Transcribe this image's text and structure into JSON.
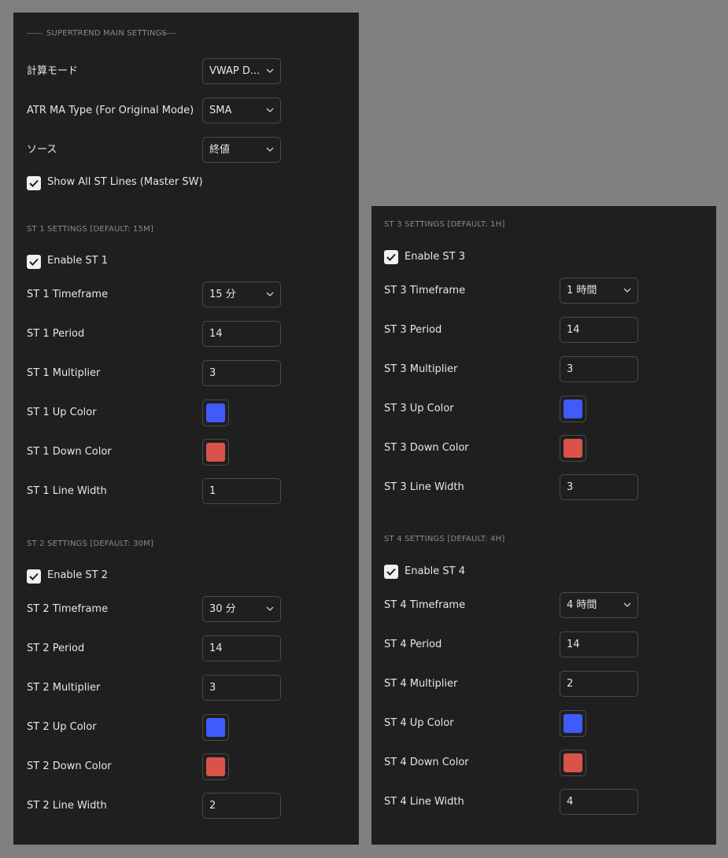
{
  "main": {
    "section_title": "SUPERTREND MAIN SETTINGS",
    "calc_mode": {
      "label": "計算モード",
      "value": "VWAP D..."
    },
    "atr_ma_type": {
      "label": "ATR MA Type (For Original Mode)",
      "value": "SMA"
    },
    "source": {
      "label": "ソース",
      "value": "終値"
    },
    "show_all": {
      "label": "Show All ST Lines (Master SW)",
      "checked": true
    }
  },
  "st1": {
    "section_title": "ST 1 SETTINGS [DEFAULT: 15M]",
    "enable_label": "Enable ST 1",
    "enabled": true,
    "timeframe_label": "ST 1 Timeframe",
    "timeframe_value": "15 分",
    "period_label": "ST 1 Period",
    "period_value": "14",
    "multiplier_label": "ST 1 Multiplier",
    "multiplier_value": "3",
    "up_color_label": "ST 1 Up Color",
    "up_color": "#3f5bfa",
    "down_color_label": "ST 1 Down Color",
    "down_color": "#d9534a",
    "line_width_label": "ST 1 Line Width",
    "line_width_value": "1"
  },
  "st2": {
    "section_title": "ST 2 SETTINGS [DEFAULT: 30M]",
    "enable_label": "Enable ST 2",
    "enabled": true,
    "timeframe_label": "ST 2 Timeframe",
    "timeframe_value": "30 分",
    "period_label": "ST 2 Period",
    "period_value": "14",
    "multiplier_label": "ST 2 Multiplier",
    "multiplier_value": "3",
    "up_color_label": "ST 2 Up Color",
    "up_color": "#3f5bfa",
    "down_color_label": "ST 2 Down Color",
    "down_color": "#d9534a",
    "line_width_label": "ST 2 Line Width",
    "line_width_value": "2"
  },
  "st3": {
    "section_title": "ST 3 SETTINGS [DEFAULT: 1H]",
    "enable_label": "Enable ST 3",
    "enabled": true,
    "timeframe_label": "ST 3 Timeframe",
    "timeframe_value": "1 時間",
    "period_label": "ST 3 Period",
    "period_value": "14",
    "multiplier_label": "ST 3 Multiplier",
    "multiplier_value": "3",
    "up_color_label": "ST 3 Up Color",
    "up_color": "#3f5bfa",
    "down_color_label": "ST 3 Down Color",
    "down_color": "#d9534a",
    "line_width_label": "ST 3 Line Width",
    "line_width_value": "3"
  },
  "st4": {
    "section_title": "ST 4 SETTINGS [DEFAULT: 4H]",
    "enable_label": "Enable ST 4",
    "enabled": true,
    "timeframe_label": "ST 4 Timeframe",
    "timeframe_value": "4 時間",
    "period_label": "ST 4 Period",
    "period_value": "14",
    "multiplier_label": "ST 4 Multiplier",
    "multiplier_value": "2",
    "up_color_label": "ST 4 Up Color",
    "up_color": "#3f5bfa",
    "down_color_label": "ST 4 Down Color",
    "down_color": "#d9534a",
    "line_width_label": "ST 4 Line Width",
    "line_width_value": "4"
  },
  "icons": {
    "chevron": "chevron-down-icon",
    "check": "checkmark-icon"
  }
}
